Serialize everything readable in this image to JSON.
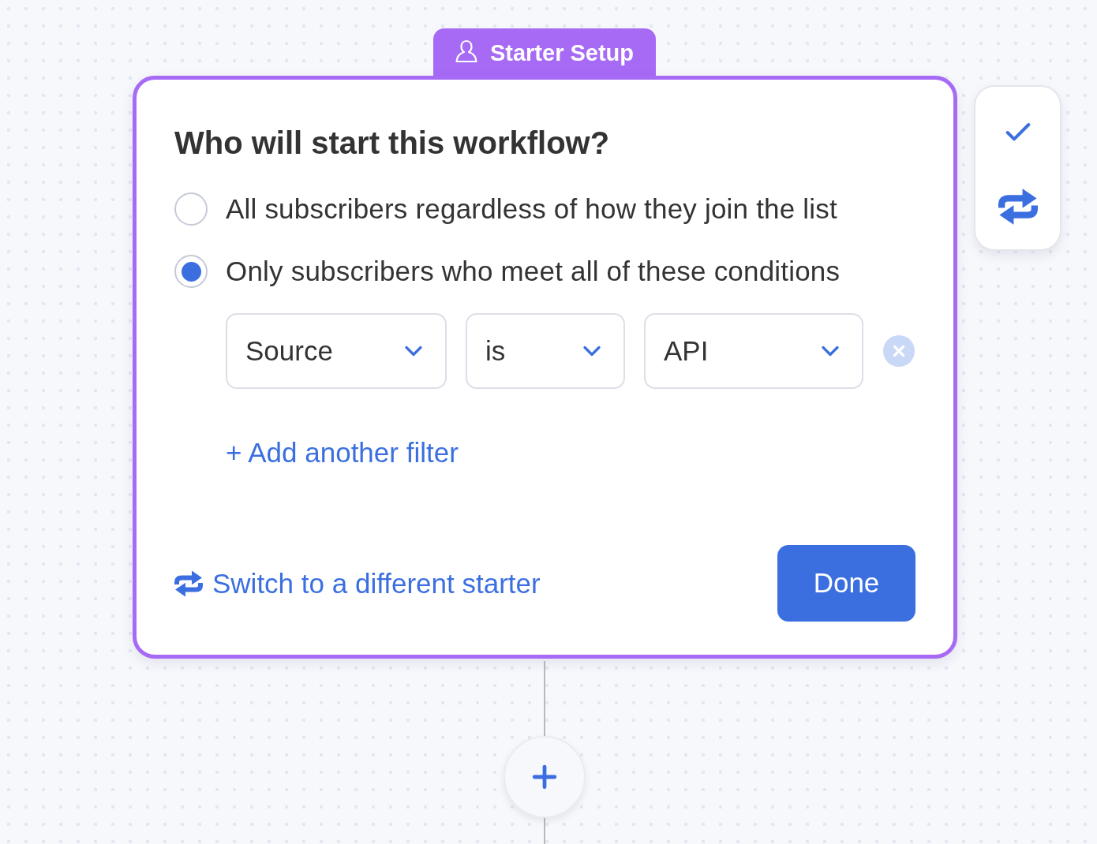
{
  "node": {
    "tab": {
      "label": "Starter Setup"
    },
    "question": "Who will start this workflow?",
    "options": [
      {
        "label": "All subscribers regardless of how they join the list",
        "selected": false
      },
      {
        "label": "Only subscribers who meet all of these conditions",
        "selected": true
      }
    ],
    "filters": [
      {
        "field": "Source",
        "operator": "is",
        "value": "API"
      }
    ],
    "add_filter": "+ Add another filter",
    "switch_link": "Switch to a different starter",
    "done_button": "Done"
  }
}
